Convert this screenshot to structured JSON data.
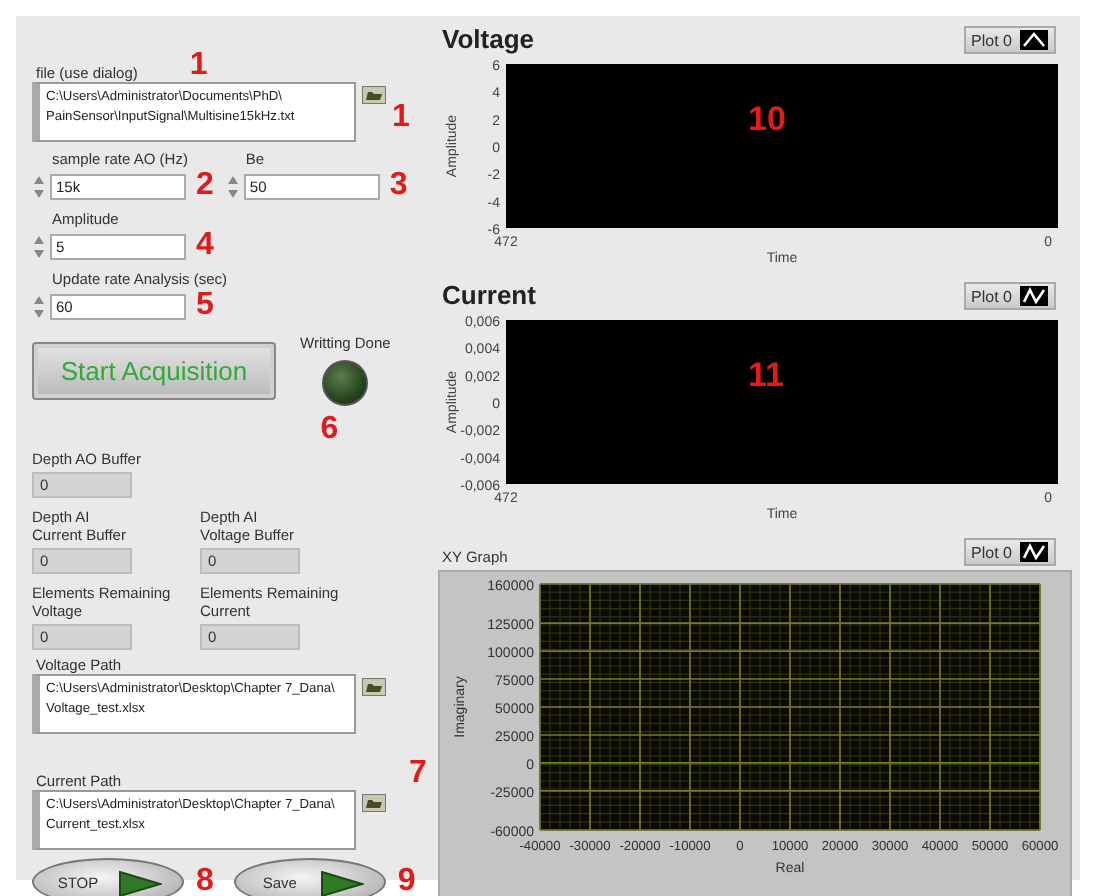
{
  "file_path": {
    "label": "file (use dialog)",
    "label_marker": "1",
    "lines": [
      "C:\\Users\\Administrator\\Documents\\PhD\\",
      "PainSensor\\InputSignal\\Multisine15kHz.txt"
    ],
    "marker": "1"
  },
  "controls": [
    {
      "label": "sample rate AO (Hz)",
      "value": "15k",
      "marker": "2"
    },
    {
      "label": "Be",
      "value": "50",
      "marker": "3"
    },
    {
      "label": "Amplitude",
      "value": "5",
      "marker": "4"
    },
    {
      "label": "Update rate Analysis (sec)",
      "value": "60",
      "marker": "5"
    }
  ],
  "start_button": {
    "label": "Start Acquisition"
  },
  "led": {
    "label": "Writting Done",
    "on": false,
    "marker": "6"
  },
  "indicators": [
    {
      "label": [
        "Depth AO Buffer"
      ],
      "value": "0"
    },
    {
      "label": [
        "Depth AI",
        "Current Buffer"
      ],
      "value": "0"
    },
    {
      "label": [
        "Depth AI",
        "Voltage Buffer"
      ],
      "value": "0"
    },
    {
      "label": [
        "Elements Remaining",
        "Voltage"
      ],
      "value": "0"
    },
    {
      "label": [
        "Elements Remaining",
        "Current"
      ],
      "value": "0"
    }
  ],
  "voltage_path": {
    "label": "Voltage Path",
    "lines": [
      "C:\\Users\\Administrator\\Desktop\\Chapter 7_Dana\\",
      "Voltage_test.xlsx"
    ]
  },
  "current_path": {
    "label": "Current Path",
    "label_marker": "7",
    "lines": [
      "C:\\Users\\Administrator\\Desktop\\Chapter 7_Dana\\",
      "Current_test.xlsx"
    ]
  },
  "buttons": [
    {
      "label": "STOP",
      "marker": "8"
    },
    {
      "label": "Save",
      "marker": "9"
    }
  ],
  "graphs": [
    {
      "kind": "chart",
      "title": "Voltage",
      "legend": "Plot 0",
      "ylabel": "Amplitude",
      "xlabel": "Time",
      "yticks": [
        "6",
        "4",
        "2",
        "0",
        "-2",
        "-4",
        "-6"
      ],
      "xticks": [
        "472",
        "0"
      ],
      "marker": "10"
    },
    {
      "kind": "chart",
      "title": "Current",
      "legend": "Plot 0",
      "ylabel": "Amplitude",
      "xlabel": "Time",
      "yticks": [
        "0,006",
        "0,004",
        "0,002",
        "0",
        "-0,002",
        "-0,004",
        "-0,006"
      ],
      "xticks": [
        "472",
        "0"
      ],
      "marker": "11"
    },
    {
      "kind": "xy",
      "title": "XY Graph",
      "legend": "Plot 0",
      "ylabel": "Imaginary",
      "xlabel": "Real",
      "yticks": [
        "160000",
        "125000",
        "100000",
        "75000",
        "50000",
        "25000",
        "0",
        "-25000",
        "-60000"
      ],
      "xticks": [
        "-40000",
        "-30000",
        "-20000",
        "-10000",
        "0",
        "10000",
        "20000",
        "30000",
        "40000",
        "50000",
        "60000"
      ]
    }
  ]
}
